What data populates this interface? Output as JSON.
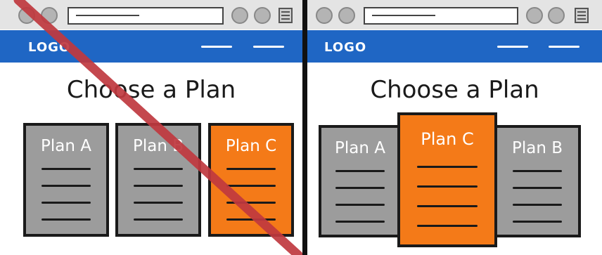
{
  "left": {
    "logo": "LOGO",
    "heading": "Choose a Plan",
    "plans": [
      {
        "title": "Plan A",
        "color": "gray"
      },
      {
        "title": "Plan B",
        "color": "gray"
      },
      {
        "title": "Plan C",
        "color": "orange"
      }
    ]
  },
  "right": {
    "logo": "LOGO",
    "heading": "Choose a Plan",
    "plans": [
      {
        "title": "Plan A",
        "color": "gray"
      },
      {
        "title": "Plan C",
        "color": "orange"
      },
      {
        "title": "Plan B",
        "color": "gray"
      }
    ]
  },
  "colors": {
    "nav": "#1f66c4",
    "plan_gray": "#9c9c9c",
    "plan_highlight": "#f47a18",
    "cross_out": "#c0393f"
  }
}
